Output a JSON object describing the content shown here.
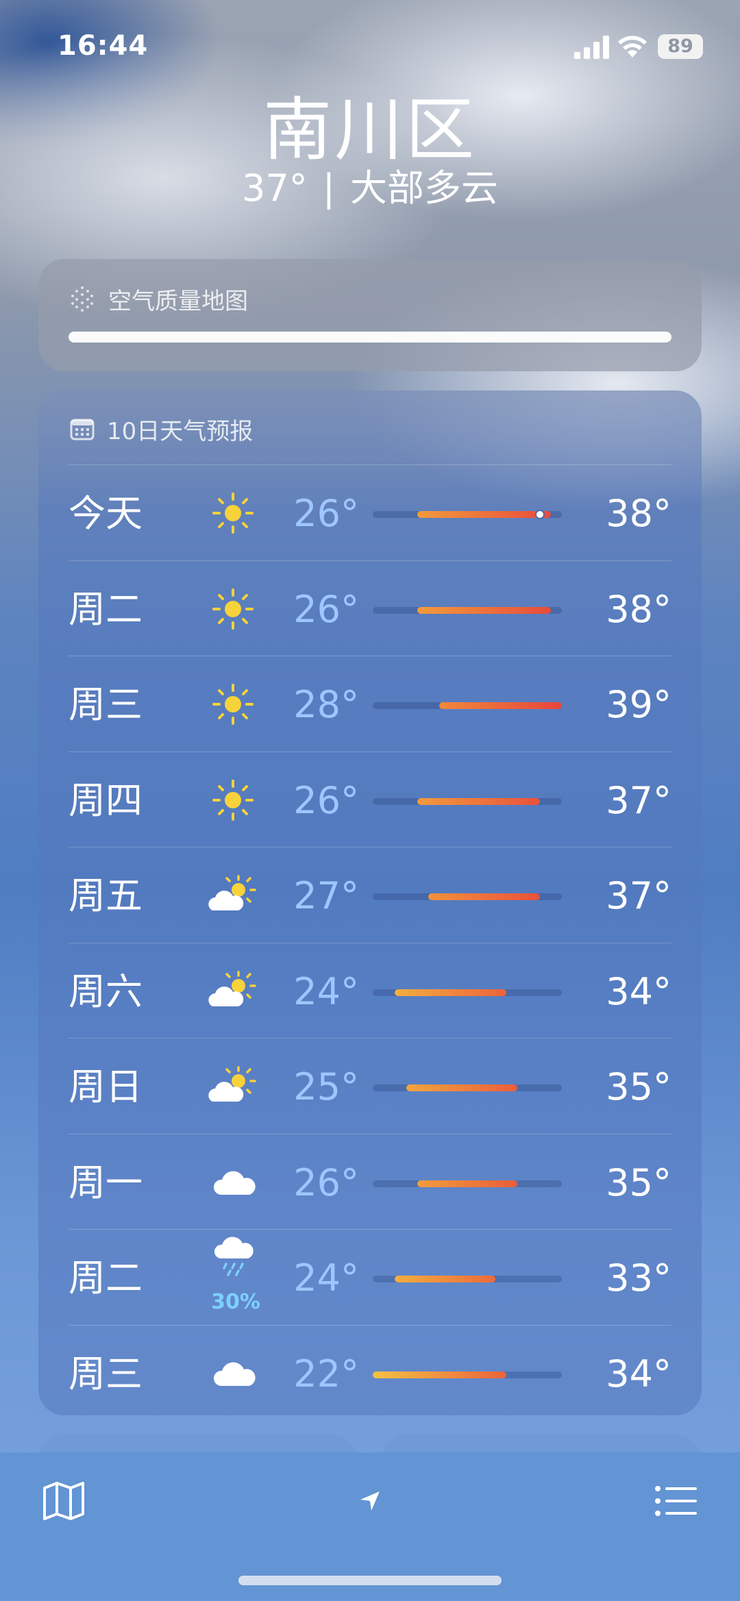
{
  "status": {
    "time": "16:44",
    "battery": "89"
  },
  "header": {
    "location": "南川区",
    "temperature": "37°",
    "separator": "|",
    "condition": "大部多云"
  },
  "air_quality": {
    "title": "空气质量地图",
    "icon": "aqi-dots-icon"
  },
  "forecast": {
    "title": "10日天气预报",
    "icon": "calendar-icon",
    "scale_min": 22,
    "scale_max": 39,
    "days": [
      {
        "day": "今天",
        "icon": "sun-icon",
        "low": "26°",
        "high": "38°",
        "lo_val": 26,
        "hi_val": 38,
        "current": 37
      },
      {
        "day": "周二",
        "icon": "sun-icon",
        "low": "26°",
        "high": "38°",
        "lo_val": 26,
        "hi_val": 38
      },
      {
        "day": "周三",
        "icon": "sun-icon",
        "low": "28°",
        "high": "39°",
        "lo_val": 28,
        "hi_val": 39
      },
      {
        "day": "周四",
        "icon": "sun-icon",
        "low": "26°",
        "high": "37°",
        "lo_val": 26,
        "hi_val": 37
      },
      {
        "day": "周五",
        "icon": "partly-cloudy-icon",
        "low": "27°",
        "high": "37°",
        "lo_val": 27,
        "hi_val": 37
      },
      {
        "day": "周六",
        "icon": "partly-cloudy-icon",
        "low": "24°",
        "high": "34°",
        "lo_val": 24,
        "hi_val": 34
      },
      {
        "day": "周日",
        "icon": "partly-cloudy-icon",
        "low": "25°",
        "high": "35°",
        "lo_val": 25,
        "hi_val": 35
      },
      {
        "day": "周一",
        "icon": "cloud-icon",
        "low": "26°",
        "high": "35°",
        "lo_val": 26,
        "hi_val": 35
      },
      {
        "day": "周二",
        "icon": "rain-cloud-icon",
        "precip": "30%",
        "low": "24°",
        "high": "33°",
        "lo_val": 24,
        "hi_val": 33
      },
      {
        "day": "周三",
        "icon": "cloud-icon",
        "low": "22°",
        "high": "34°",
        "lo_val": 22,
        "hi_val": 34
      }
    ]
  },
  "tab_bar": {
    "left": "map-icon",
    "center": "location-arrow-icon",
    "right": "list-icon"
  }
}
